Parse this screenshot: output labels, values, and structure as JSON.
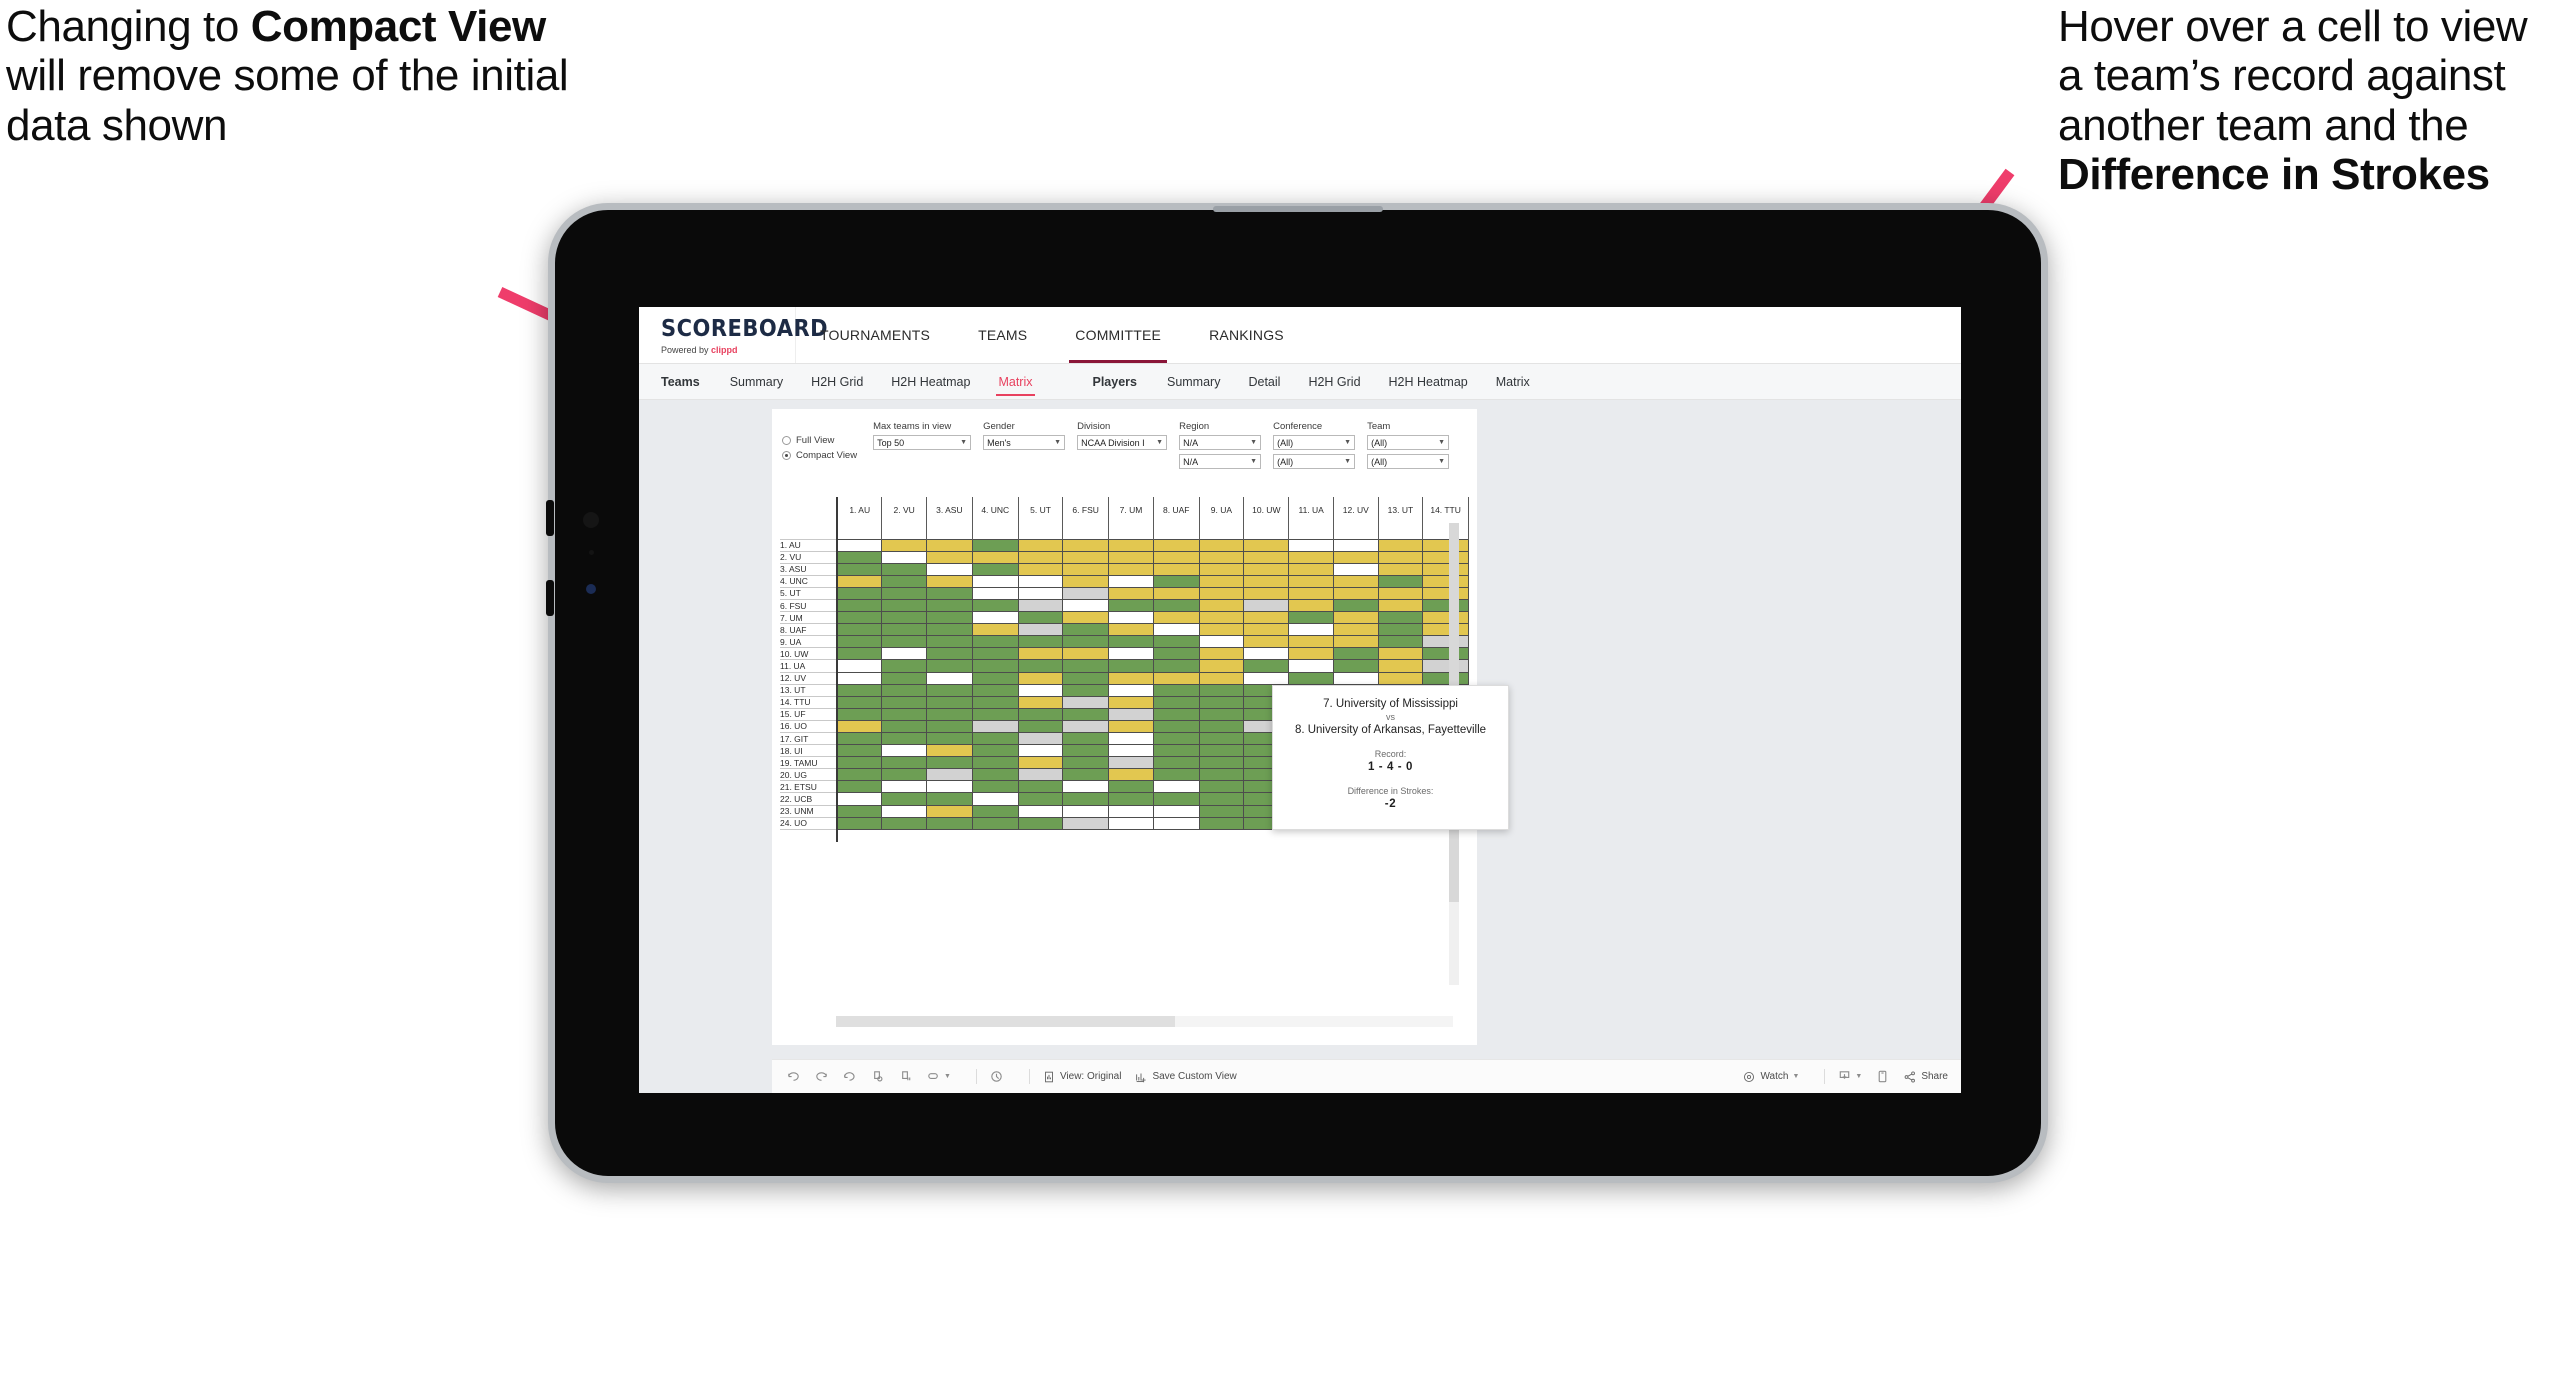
{
  "annotations": {
    "left": {
      "pre": "Changing to ",
      "bold": "Compact View",
      "post": " will remove some of the initial data shown"
    },
    "right": {
      "pre": "Hover over a cell to view a team’s record against another team and the ",
      "bold": "Difference in Strokes",
      "post": ""
    },
    "arrow_color": "#ef3d6b"
  },
  "app": {
    "brand": {
      "title": "SCOREBOARD",
      "powered_prefix": "Powered by ",
      "powered_name": "clippd"
    },
    "topnav": [
      {
        "label": "TOURNAMENTS",
        "active": false
      },
      {
        "label": "TEAMS",
        "active": false
      },
      {
        "label": "COMMITTEE",
        "active": true
      },
      {
        "label": "RANKINGS",
        "active": false
      }
    ],
    "subnav": {
      "teams_group": [
        "Teams",
        "Summary",
        "H2H Grid",
        "H2H Heatmap",
        "Matrix"
      ],
      "teams_head": "Teams",
      "teams_selected": "Matrix",
      "players_group": [
        "Players",
        "Summary",
        "Detail",
        "H2H Grid",
        "H2H Heatmap",
        "Matrix"
      ],
      "players_head": "Players"
    }
  },
  "filters": {
    "view_mode": {
      "full_label": "Full View",
      "compact_label": "Compact View",
      "selected": "Compact View"
    },
    "controls": [
      {
        "label": "Max teams in view",
        "values": [
          "Top 50"
        ],
        "width": "w-maxteams"
      },
      {
        "label": "Gender",
        "values": [
          "Men's"
        ],
        "width": "w-gender"
      },
      {
        "label": "Division",
        "values": [
          "NCAA Division I"
        ],
        "width": "w-div"
      },
      {
        "label": "Region",
        "values": [
          "N/A",
          "N/A"
        ],
        "width": "w-region"
      },
      {
        "label": "Conference",
        "values": [
          "(All)",
          "(All)"
        ],
        "width": "w-conf"
      },
      {
        "label": "Team",
        "values": [
          "(All)",
          "(All)"
        ],
        "width": "w-team"
      }
    ]
  },
  "matrix": {
    "columns": [
      "1. AU",
      "2. VU",
      "3. ASU",
      "4. UNC",
      "5. UT",
      "6. FSU",
      "7. UM",
      "8. UAF",
      "9. UA",
      "10. UW",
      "11. UA",
      "12. UV",
      "13. UT",
      "14. TTU"
    ],
    "rows": [
      "1. AU",
      "2. VU",
      "3. ASU",
      "4. UNC",
      "5. UT",
      "6. FSU",
      "7. UM",
      "8. UAF",
      "9. UA",
      "10. UW",
      "11. UA",
      "12. UV",
      "13. UT",
      "14. TTU",
      "15. UF",
      "16. UO",
      "17. GIT",
      "18. UI",
      "19. TAMU",
      "20. UG",
      "21. ETSU",
      "22. UCB",
      "23. UNM",
      "24. UO"
    ],
    "legend": {
      "win": "#6d9e54",
      "loss": "#e2c750",
      "tie": "#d2d2d2",
      "none": "#ffffff"
    },
    "cells": [
      [
        "w",
        "y",
        "y",
        "g",
        "y",
        "y",
        "y",
        "y",
        "y",
        "y",
        "w",
        "w",
        "y",
        "y"
      ],
      [
        "g",
        "w",
        "y",
        "y",
        "y",
        "y",
        "y",
        "y",
        "y",
        "y",
        "y",
        "y",
        "y",
        "y"
      ],
      [
        "g",
        "g",
        "w",
        "g",
        "y",
        "y",
        "y",
        "y",
        "y",
        "y",
        "y",
        "w",
        "y",
        "y"
      ],
      [
        "y",
        "g",
        "y",
        "w",
        "w",
        "y",
        "w",
        "g",
        "y",
        "y",
        "y",
        "y",
        "g",
        "y"
      ],
      [
        "g",
        "g",
        "g",
        "w",
        "w",
        "s",
        "y",
        "y",
        "y",
        "y",
        "y",
        "y",
        "y",
        "y"
      ],
      [
        "g",
        "g",
        "g",
        "g",
        "s",
        "w",
        "g",
        "g",
        "y",
        "s",
        "y",
        "g",
        "y",
        "g"
      ],
      [
        "g",
        "g",
        "g",
        "w",
        "g",
        "y",
        "w",
        "y",
        "y",
        "y",
        "g",
        "y",
        "g",
        "y"
      ],
      [
        "g",
        "g",
        "g",
        "y",
        "s",
        "g",
        "y",
        "w",
        "y",
        "y",
        "w",
        "y",
        "g",
        "y"
      ],
      [
        "g",
        "g",
        "g",
        "g",
        "g",
        "g",
        "g",
        "g",
        "w",
        "y",
        "y",
        "y",
        "g",
        "s"
      ],
      [
        "g",
        "w",
        "g",
        "g",
        "y",
        "y",
        "w",
        "g",
        "y",
        "w",
        "y",
        "g",
        "y",
        "g"
      ],
      [
        "w",
        "g",
        "g",
        "g",
        "g",
        "g",
        "g",
        "g",
        "y",
        "g",
        "w",
        "g",
        "y",
        "s"
      ],
      [
        "w",
        "g",
        "w",
        "g",
        "y",
        "g",
        "y",
        "y",
        "y",
        "w",
        "g",
        "w",
        "y",
        "g"
      ],
      [
        "g",
        "g",
        "g",
        "g",
        "w",
        "g",
        "w",
        "g",
        "g",
        "g",
        "g",
        "g",
        "w",
        "y"
      ],
      [
        "g",
        "g",
        "g",
        "g",
        "y",
        "s",
        "y",
        "g",
        "g",
        "g",
        "g",
        "g",
        "g",
        "w"
      ],
      [
        "g",
        "g",
        "g",
        "g",
        "g",
        "g",
        "s",
        "g",
        "g",
        "g",
        "g",
        "g",
        "g",
        "g"
      ],
      [
        "y",
        "g",
        "g",
        "s",
        "g",
        "s",
        "y",
        "g",
        "g",
        "s",
        "g",
        "g",
        "y",
        "g"
      ],
      [
        "g",
        "g",
        "g",
        "g",
        "s",
        "g",
        "w",
        "g",
        "g",
        "g",
        "g",
        "g",
        "w",
        "y"
      ],
      [
        "g",
        "w",
        "y",
        "g",
        "w",
        "g",
        "w",
        "g",
        "g",
        "g",
        "g",
        "w",
        "w",
        "y"
      ],
      [
        "g",
        "g",
        "g",
        "g",
        "y",
        "g",
        "s",
        "g",
        "g",
        "g",
        "g",
        "g",
        "g",
        "g"
      ],
      [
        "g",
        "g",
        "s",
        "g",
        "s",
        "g",
        "y",
        "g",
        "g",
        "g",
        "g",
        "g",
        "g",
        "g"
      ],
      [
        "g",
        "w",
        "w",
        "g",
        "g",
        "w",
        "g",
        "w",
        "g",
        "g",
        "g",
        "g",
        "g",
        "g"
      ],
      [
        "w",
        "g",
        "g",
        "w",
        "g",
        "g",
        "g",
        "g",
        "g",
        "g",
        "g",
        "g",
        "g",
        "w"
      ],
      [
        "g",
        "w",
        "y",
        "g",
        "w",
        "w",
        "w",
        "w",
        "g",
        "g",
        "g",
        "g",
        "w",
        "g"
      ],
      [
        "g",
        "g",
        "g",
        "g",
        "g",
        "s",
        "w",
        "w",
        "g",
        "g",
        "g",
        "g",
        "w",
        "g"
      ]
    ]
  },
  "tooltip": {
    "team_a": "7. University of Mississippi",
    "vs": "vs",
    "team_b": "8. University of Arkansas, Fayetteville",
    "record_label": "Record:",
    "record_value": "1 - 4 - 0",
    "diff_label": "Difference in Strokes:",
    "diff_value": "-2"
  },
  "toolbar": {
    "view_label": "View: Original",
    "save_label": "Save Custom View",
    "watch_label": "Watch",
    "share_label": "Share",
    "icons": [
      "undo-icon",
      "redo-icon",
      "revert-icon",
      "refresh-icon",
      "pause-icon",
      "rectangle-select-icon",
      "clock-icon",
      "view-original-icon",
      "save-custom-view-icon",
      "watch-icon",
      "download-icon",
      "device-preview-icon",
      "share-icon"
    ]
  }
}
